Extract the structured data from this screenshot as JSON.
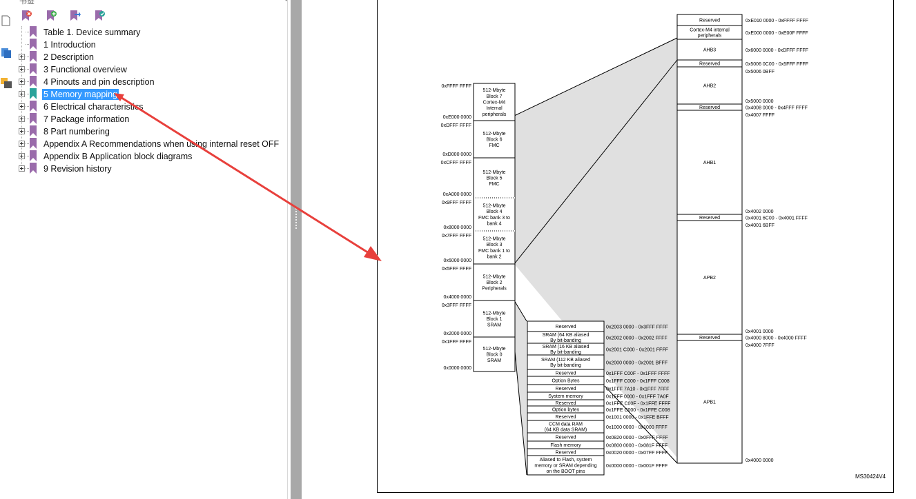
{
  "bookmarks_panel": {
    "title": "书签",
    "toolbar": [
      {
        "name": "delete-bookmark-icon"
      },
      {
        "name": "new-bookmark-icon"
      },
      {
        "name": "expand-bookmark-icon"
      },
      {
        "name": "find-bookmark-icon"
      }
    ],
    "items": [
      {
        "label": "Table 1. Device summary",
        "expandable": false
      },
      {
        "label": "1 Introduction",
        "expandable": false
      },
      {
        "label": "2 Description",
        "expandable": true
      },
      {
        "label": "3 Functional overview",
        "expandable": true
      },
      {
        "label": "4 Pinouts and pin description",
        "expandable": true
      },
      {
        "label": "5 Memory mapping",
        "expandable": true,
        "selected": true
      },
      {
        "label": "6 Electrical characteristics",
        "expandable": true
      },
      {
        "label": "7 Package information",
        "expandable": true
      },
      {
        "label": "8 Part numbering",
        "expandable": true
      },
      {
        "label": "Appendix A Recommendations when using internal reset OFF",
        "expandable": true
      },
      {
        "label": "Appendix B Application block diagrams",
        "expandable": true
      },
      {
        "label": "9 Revision history",
        "expandable": true
      }
    ]
  },
  "memory_map": {
    "figure_id": "MS30424V4",
    "main_blocks": [
      {
        "text": "512-Mbyte|Block 7|Cortex-M4|Internal|peripherals",
        "top_addr": "0xFFFF FFFF",
        "bottom_addr": "0xE000 0000"
      },
      {
        "text": "512-Mbyte|Block 6|FMC",
        "top_addr": "0xDFFF FFFF",
        "bottom_addr": "0xD000 0000"
      },
      {
        "text": "512-Mbyte|Block 5|FMC",
        "top_addr": "0xCFFF FFFF",
        "bottom_addr": "0xA000 0000"
      },
      {
        "text": "512-Mbyte|Block 4|FMC bank 3 to|bank 4",
        "top_addr": "0x9FFF FFFF",
        "bottom_addr": "0x8000 0000"
      },
      {
        "text": "512-Mbyte|Block 3|FMC bank 1 to|bank 2",
        "top_addr": "0x7FFF FFFF",
        "bottom_addr": "0x6000 0000"
      },
      {
        "text": "512-Mbyte|Block 2|Peripherals",
        "top_addr": "0x5FFF FFFF",
        "bottom_addr": "0x4000 0000"
      },
      {
        "text": "512-Mbyte|Block 1|SRAM",
        "top_addr": "0x3FFF FFFF",
        "bottom_addr": "0x2000 0000"
      },
      {
        "text": "512-Mbyte|Block 0|SRAM",
        "top_addr": "0x1FFF FFFF",
        "bottom_addr": "0x0000 0000"
      }
    ],
    "right_regions": [
      {
        "name": "Reserved",
        "addr": "0xE010 0000 - 0xFFFF FFFF"
      },
      {
        "name": "Cortex-M4 internal|peripherals",
        "addr": "0xE000 0000 - 0xE00F FFFF"
      },
      {
        "name": "AHB3",
        "addr": "0x6000 0000 - 0xDFFF FFFF"
      },
      {
        "name": "Reserved",
        "addr": "0x5006 0C00 - 0x5FFF FFFF"
      },
      {
        "name": "AHB2",
        "addr_top": "0x5006 0BFF",
        "addr_bottom": "0x5000 0000"
      },
      {
        "name": "Reserved",
        "addr": "0x4008 0000 - 0x4FFF FFFF"
      },
      {
        "name": "AHB1",
        "addr_top": "0x4007 FFFF",
        "addr_bottom": "0x4002 0000"
      },
      {
        "name": "Reserved",
        "addr": "0x4001 6C00 - 0x4001 FFFF"
      },
      {
        "name": "APB2",
        "addr_top": "0x4001 6BFF",
        "addr_bottom": "0x4001 0000"
      },
      {
        "name": "Reserved",
        "addr": "0x4000 8000 - 0x4000 FFFF"
      },
      {
        "name": "APB1",
        "addr_top": "0x4000 7FFF",
        "addr_bottom": "0x4000 0000"
      }
    ],
    "low_regions": [
      {
        "name": "Reserved",
        "addr": "0x2003 0000 - 0x3FFF FFFF"
      },
      {
        "name": "SRAM (64 KB aliased|By bit-banding",
        "addr": "0x2002 0000 - 0x2002 FFFF"
      },
      {
        "name": "SRAM (16 KB aliased|By bit-banding",
        "addr": "0x2001 C000 - 0x2001 FFFF"
      },
      {
        "name": "SRAM (112 KB aliased|By bit-banding",
        "addr": "0x2000 0000 - 0x2001 BFFF"
      },
      {
        "name": "Reserved",
        "addr": "0x1FFF C00F - 0x1FFF FFFF"
      },
      {
        "name": "Option Bytes",
        "addr": "0x1FFF C000 - 0x1FFF C008"
      },
      {
        "name": "Reserved",
        "addr": "0x1FFF 7A10 - 0x1FFF 7FFF"
      },
      {
        "name": "System memory",
        "addr": "0x1FFF 0000 - 0x1FFF 7A0F"
      },
      {
        "name": "Reserved",
        "addr": "0x1FFE C00F - 0x1FFE FFFF"
      },
      {
        "name": "Option bytes",
        "addr": "0x1FFE C000 - 0x1FFE C008"
      },
      {
        "name": "Reserved",
        "addr": "0x1001 0000 - 0x1FFE BFFF"
      },
      {
        "name": "CCM data RAM|(64 KB data SRAM)",
        "addr": "0x1000 0000 - 0x1000 FFFF"
      },
      {
        "name": "Reserved",
        "addr": "0x0820 0000 - 0x0FFF FFFF"
      },
      {
        "name": "Flash memory",
        "addr": "0x0800 0000 - 0x081F FFFF"
      },
      {
        "name": "Reserved",
        "addr": "0x0020 0000 - 0x07FF FFFF"
      },
      {
        "name": "Aliased to Flash, system|memory or SRAM depending|on the BOOT pins",
        "addr": "0x0000 0000 - 0x001F FFFF"
      }
    ]
  },
  "colors": {
    "selection": "#3399ff",
    "arrow": "#e8403c",
    "bookmark_icon": "#9a6bab",
    "bookmark_icon_selected": "#2aa39a",
    "splitter": "#a8a8a8",
    "fan_fill": "#e0e0e0"
  }
}
